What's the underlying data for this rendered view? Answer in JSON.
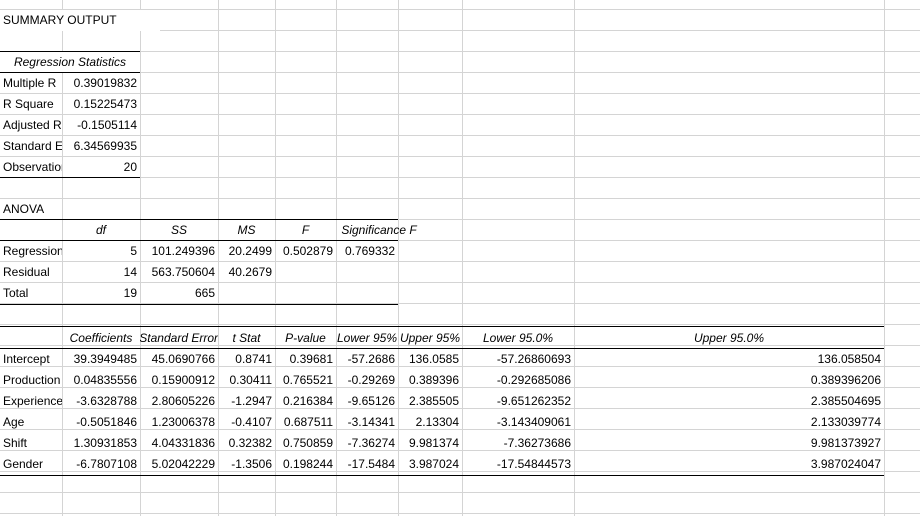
{
  "title": "SUMMARY OUTPUT",
  "regression_statistics": {
    "header": "Regression Statistics",
    "rows": [
      {
        "label": "Multiple R",
        "value": "0.39019832"
      },
      {
        "label": "R Square",
        "value": "0.15225473"
      },
      {
        "label": "Adjusted R Square",
        "value": "-0.1505114"
      },
      {
        "label": "Standard Error",
        "value": "6.34569935"
      },
      {
        "label": "Observations",
        "value": "20"
      }
    ]
  },
  "anova": {
    "title": "ANOVA",
    "headers": [
      "",
      "df",
      "SS",
      "MS",
      "F",
      "Significance F"
    ],
    "rows": [
      {
        "label": "Regression",
        "df": "5",
        "ss": "101.249396",
        "ms": "20.2499",
        "f": "0.502879",
        "sig": "0.769332"
      },
      {
        "label": "Residual",
        "df": "14",
        "ss": "563.750604",
        "ms": "40.2679",
        "f": "",
        "sig": ""
      },
      {
        "label": "Total",
        "df": "19",
        "ss": "665",
        "ms": "",
        "f": "",
        "sig": ""
      }
    ]
  },
  "coefficients": {
    "headers": [
      "",
      "Coefficients",
      "Standard Error",
      "t Stat",
      "P-value",
      "Lower 95%",
      "Upper 95%",
      "Lower 95.0%",
      "Upper 95.0%"
    ],
    "rows": [
      {
        "label": "Intercept",
        "coef": "39.3949485",
        "se": "45.0690766",
        "t": "0.8741",
        "p": "0.39681",
        "lo": "-57.2686",
        "hi": "136.0585",
        "lo2": "-57.26860693",
        "hi2": "136.058504"
      },
      {
        "label": "Production",
        "coef": "0.04835556",
        "se": "0.15900912",
        "t": "0.30411",
        "p": "0.765521",
        "lo": "-0.29269",
        "hi": "0.389396",
        "lo2": "-0.292685086",
        "hi2": "0.389396206"
      },
      {
        "label": "Experience",
        "coef": "-3.6328788",
        "se": "2.80605226",
        "t": "-1.2947",
        "p": "0.216384",
        "lo": "-9.65126",
        "hi": "2.385505",
        "lo2": "-9.651262352",
        "hi2": "2.385504695"
      },
      {
        "label": "Age",
        "coef": "-0.5051846",
        "se": "1.23006378",
        "t": "-0.4107",
        "p": "0.687511",
        "lo": "-3.14341",
        "hi": "2.13304",
        "lo2": "-3.143409061",
        "hi2": "2.133039774"
      },
      {
        "label": "Shift",
        "coef": "1.30931853",
        "se": "4.04331836",
        "t": "0.32382",
        "p": "0.750859",
        "lo": "-7.36274",
        "hi": "9.981374",
        "lo2": "-7.36273686",
        "hi2": "9.981373927"
      },
      {
        "label": "Gender",
        "coef": "-6.7807108",
        "se": "5.02042229",
        "t": "-1.3506",
        "p": "0.198244",
        "lo": "-17.5484",
        "hi": "3.987024",
        "lo2": "-17.54844573",
        "hi2": "3.987024047"
      }
    ]
  }
}
